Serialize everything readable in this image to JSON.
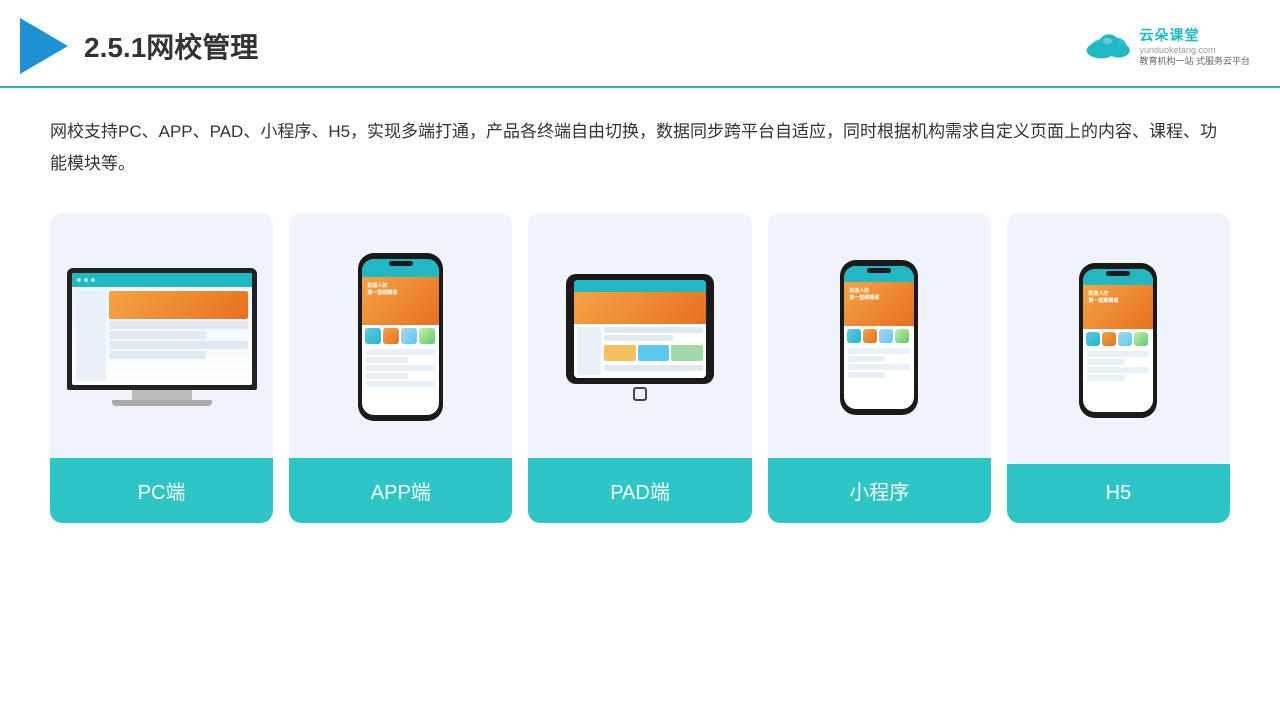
{
  "header": {
    "title": "2.5.1网校管理",
    "brand": {
      "name": "云朵课堂",
      "slogan": "教育机构一站\n式服务云平台",
      "url": "yunduoketang.com"
    }
  },
  "main": {
    "description": "网校支持PC、APP、PAD、小程序、H5，实现多端打通，产品各终端自由切换，数据同步跨平台自适应，同时根据机构需求自定义页面上的内容、课程、功能模块等。",
    "cards": [
      {
        "id": "pc",
        "label": "PC端"
      },
      {
        "id": "app",
        "label": "APP端"
      },
      {
        "id": "pad",
        "label": "PAD端"
      },
      {
        "id": "miniprogram",
        "label": "小程序"
      },
      {
        "id": "h5",
        "label": "H5"
      }
    ]
  },
  "colors": {
    "accent": "#2dc5c5",
    "accent_dark": "#1fb8c3",
    "brand_blue": "#1e90d4",
    "orange": "#f4a444",
    "bg_card": "#f0f4fa"
  }
}
